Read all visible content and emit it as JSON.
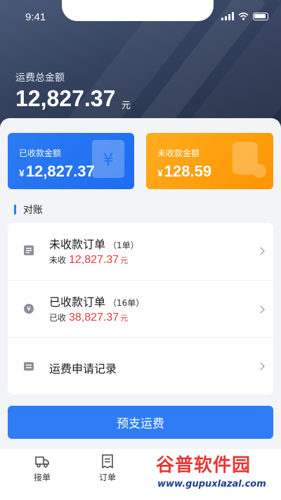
{
  "status_bar": {
    "time": "9:41"
  },
  "header": {
    "total_label": "运费总金额",
    "total_amount": "12,827.37",
    "total_unit": "元"
  },
  "cards": {
    "received": {
      "label": "已收款金额",
      "currency": "¥",
      "amount": "12,827.37",
      "color": "#2b7cf5"
    },
    "unreceived": {
      "label": "未收款金额",
      "currency": "¥",
      "amount": "128.59",
      "color": "#ff9d0a"
    }
  },
  "section": {
    "title": "对账"
  },
  "list": [
    {
      "title": "未收款订单",
      "count": "（1单）",
      "sub_label": "未收",
      "amount": "12,827.37",
      "unit": "元"
    },
    {
      "title": "已收款订单",
      "count": "（16单）",
      "sub_label": "已收",
      "amount": "38,827.37",
      "unit": "元"
    },
    {
      "title": "运费申请记录"
    }
  ],
  "primary_button": {
    "label": "预支运费"
  },
  "tabbar": {
    "items": [
      {
        "label": "接单",
        "icon": "truck-icon"
      },
      {
        "label": "订单",
        "icon": "receipt-icon"
      }
    ]
  },
  "watermark": {
    "title": "谷普软件园",
    "url": "www.gupuxlazal.com"
  },
  "colors": {
    "accent": "#2f7cf6",
    "warning": "#ff9d0a",
    "amount_red": "#e23c3c"
  }
}
